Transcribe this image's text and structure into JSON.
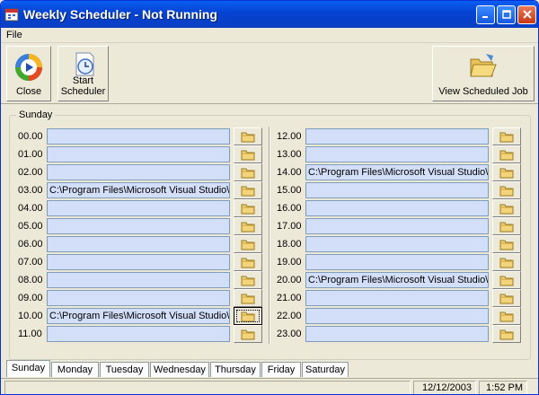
{
  "window": {
    "title": "Weekly Scheduler - Not Running"
  },
  "menu": {
    "file": "File"
  },
  "toolbar": {
    "close": "Close",
    "start_line1": "Start",
    "start_line2": "Scheduler",
    "view": "View Scheduled Job"
  },
  "group": {
    "label": "Sunday"
  },
  "slots_left": [
    {
      "hour": "00.00",
      "value": ""
    },
    {
      "hour": "01.00",
      "value": ""
    },
    {
      "hour": "02.00",
      "value": ""
    },
    {
      "hour": "03.00",
      "value": "C:\\Program Files\\Microsoft Visual Studio\\"
    },
    {
      "hour": "04.00",
      "value": ""
    },
    {
      "hour": "05.00",
      "value": ""
    },
    {
      "hour": "06.00",
      "value": ""
    },
    {
      "hour": "07.00",
      "value": ""
    },
    {
      "hour": "08.00",
      "value": ""
    },
    {
      "hour": "09.00",
      "value": ""
    },
    {
      "hour": "10.00",
      "value": "C:\\Program Files\\Microsoft Visual Studio\\"
    },
    {
      "hour": "11.00",
      "value": ""
    }
  ],
  "slots_right": [
    {
      "hour": "12.00",
      "value": ""
    },
    {
      "hour": "13.00",
      "value": ""
    },
    {
      "hour": "14.00",
      "value": "C:\\Program Files\\Microsoft Visual Studio\\"
    },
    {
      "hour": "15.00",
      "value": ""
    },
    {
      "hour": "16.00",
      "value": ""
    },
    {
      "hour": "17.00",
      "value": ""
    },
    {
      "hour": "18.00",
      "value": ""
    },
    {
      "hour": "19.00",
      "value": ""
    },
    {
      "hour": "20.00",
      "value": "C:\\Program Files\\Microsoft Visual Studio\\"
    },
    {
      "hour": "21.00",
      "value": ""
    },
    {
      "hour": "22.00",
      "value": ""
    },
    {
      "hour": "23.00",
      "value": ""
    }
  ],
  "tabs": [
    "Sunday",
    "Monday",
    "Tuesday",
    "Wednesday",
    "Thursday",
    "Friday",
    "Saturday"
  ],
  "selected_tab": "Sunday",
  "status": {
    "date": "12/12/2003",
    "time": "1:52 PM"
  },
  "icons": {
    "app": "calendar-app-icon",
    "close": "media-player-icon",
    "start": "clock-document-icon",
    "view": "open-folder-icon",
    "browse": "folder-icon"
  }
}
